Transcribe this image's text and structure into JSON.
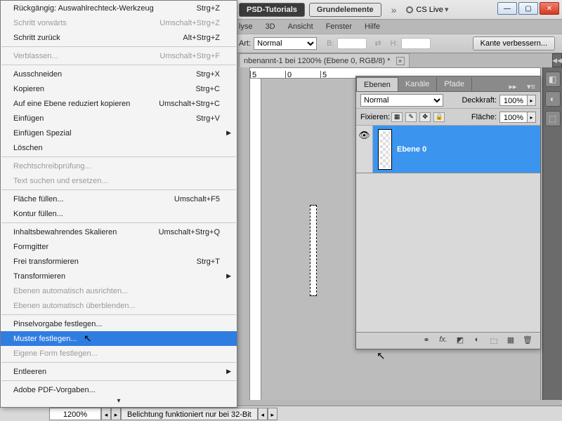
{
  "appbar": {
    "tab1": "PSD-Tutorials",
    "tab2": "Grundelemente",
    "cslive": "CS Live"
  },
  "menubar": {
    "items": [
      "lyse",
      "3D",
      "Ansicht",
      "Fenster",
      "Hilfe"
    ]
  },
  "optbar": {
    "artLabel": "Art:",
    "artValue": "Normal",
    "b": "B:",
    "h": "H:",
    "refine": "Kante verbessern..."
  },
  "doctab": {
    "title": "nbenannt-1 bei 1200% (Ebene 0, RGB/8) *"
  },
  "ruler": {
    "t0": "5",
    "t1": "0",
    "t2": "5"
  },
  "panel": {
    "tabs": {
      "layers": "Ebenen",
      "channels": "Kanäle",
      "paths": "Pfade"
    },
    "blend": "Normal",
    "opacityLabel": "Deckkraft:",
    "opacity": "100%",
    "lockLabel": "Fixieren:",
    "fillLabel": "Fläche:",
    "fill": "100%",
    "layerName": "Ebene 0"
  },
  "status": {
    "zoom": "1200%",
    "msg": "Belichtung funktioniert nur bei 32-Bit"
  },
  "menu": {
    "items": [
      {
        "l": "Rückgängig: Auswahlrechteck-Werkzeug",
        "s": "Strg+Z"
      },
      {
        "l": "Schritt vorwärts",
        "s": "Umschalt+Strg+Z",
        "d": true
      },
      {
        "l": "Schritt zurück",
        "s": "Alt+Strg+Z"
      },
      null,
      {
        "l": "Verblassen...",
        "s": "Umschalt+Strg+F",
        "d": true
      },
      null,
      {
        "l": "Ausschneiden",
        "s": "Strg+X"
      },
      {
        "l": "Kopieren",
        "s": "Strg+C"
      },
      {
        "l": "Auf eine Ebene reduziert kopieren",
        "s": "Umschalt+Strg+C"
      },
      {
        "l": "Einfügen",
        "s": "Strg+V"
      },
      {
        "l": "Einfügen Spezial",
        "sub": true
      },
      {
        "l": "Löschen"
      },
      null,
      {
        "l": "Rechtschreibprüfung...",
        "d": true
      },
      {
        "l": "Text suchen und ersetzen...",
        "d": true
      },
      null,
      {
        "l": "Fläche füllen...",
        "s": "Umschalt+F5"
      },
      {
        "l": "Kontur füllen..."
      },
      null,
      {
        "l": "Inhaltsbewahrendes Skalieren",
        "s": "Umschalt+Strg+Q"
      },
      {
        "l": "Formgitter"
      },
      {
        "l": "Frei transformieren",
        "s": "Strg+T"
      },
      {
        "l": "Transformieren",
        "sub": true
      },
      {
        "l": "Ebenen automatisch ausrichten...",
        "d": true
      },
      {
        "l": "Ebenen automatisch überblenden...",
        "d": true
      },
      null,
      {
        "l": "Pinselvorgabe festlegen..."
      },
      {
        "l": "Muster festlegen...",
        "sel": true
      },
      {
        "l": "Eigene Form festlegen...",
        "d": true
      },
      null,
      {
        "l": "Entleeren",
        "sub": true
      },
      null,
      {
        "l": "Adobe PDF-Vorgaben..."
      }
    ]
  }
}
